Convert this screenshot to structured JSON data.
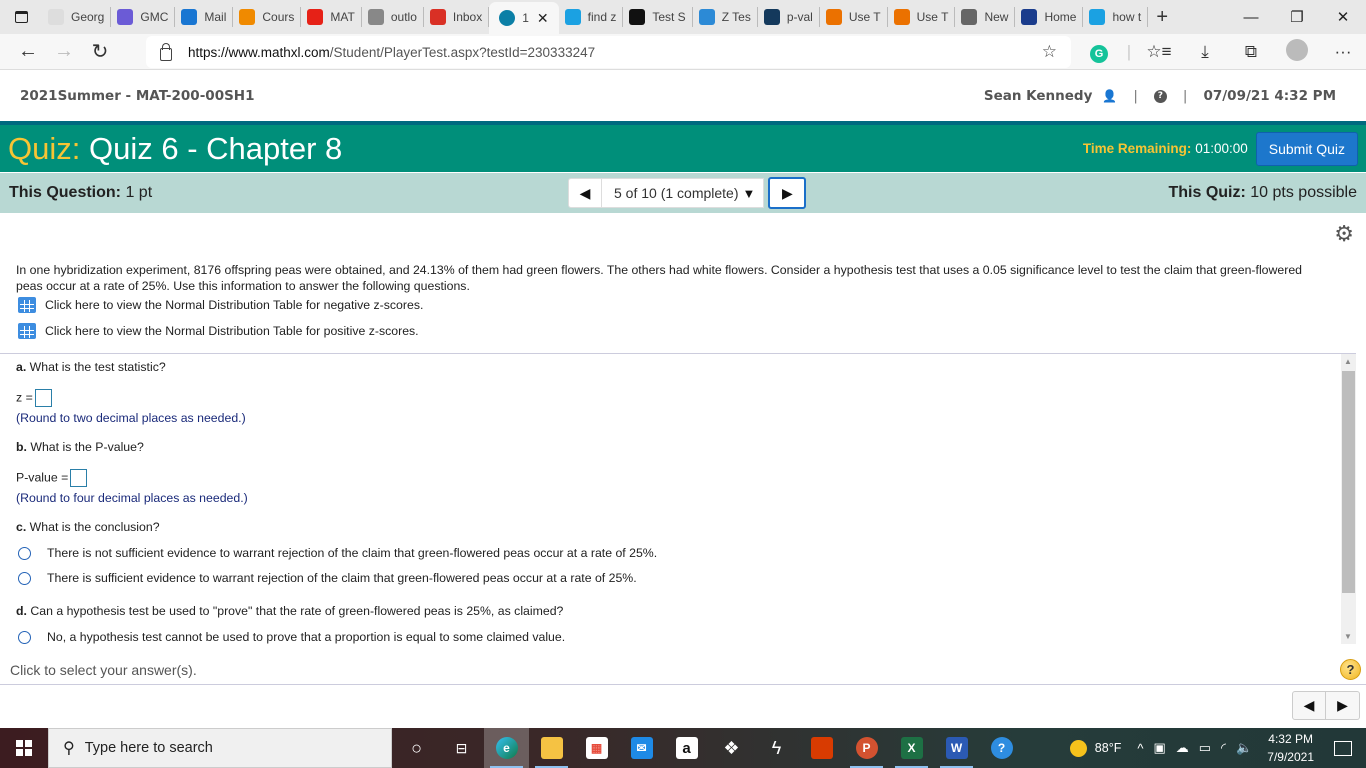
{
  "browser": {
    "tabs": [
      {
        "label": "Georg",
        "icon": "gmc-icon",
        "color": "#ddd"
      },
      {
        "label": "GMC",
        "icon": "gmc-circle-icon",
        "color": "#6b5bd6"
      },
      {
        "label": "Mail",
        "icon": "outlook-icon",
        "color": "#1976d2"
      },
      {
        "label": "Cours",
        "icon": "moodle-icon",
        "color": "#f08a00"
      },
      {
        "label": "MAT",
        "icon": "youtube-icon",
        "color": "#e62117"
      },
      {
        "label": "outlo",
        "icon": "file-icon",
        "color": "#888"
      },
      {
        "label": "Inbox",
        "icon": "gmail-icon",
        "color": "#d93025"
      },
      {
        "label": "1",
        "icon": "pearson-icon",
        "color": "#0b7fa6",
        "active": true
      },
      {
        "label": "find z",
        "icon": "bing-icon",
        "color": "#1ba1e2"
      },
      {
        "label": "Test S",
        "icon": "l-icon",
        "color": "#111"
      },
      {
        "label": "Z Tes",
        "icon": "ztest-icon",
        "color": "#2c8ad6"
      },
      {
        "label": "p-val",
        "icon": "pval-icon",
        "color": "#14395c"
      },
      {
        "label": "Use T",
        "icon": "chegg-icon",
        "color": "#eb7100"
      },
      {
        "label": "Use T",
        "icon": "chegg-icon",
        "color": "#eb7100"
      },
      {
        "label": "New",
        "icon": "newtab-icon",
        "color": "#666"
      },
      {
        "label": "Home",
        "icon": "shield-star-icon",
        "color": "#1a3c8c"
      },
      {
        "label": "how t",
        "icon": "bing-icon",
        "color": "#1ba1e2"
      }
    ],
    "url_host": "https://www.mathxl.com",
    "url_path": "/Student/PlayerTest.aspx?testId=230333247"
  },
  "header": {
    "course": "2021Summer - MAT-200-00SH1",
    "user": "Sean Kennedy",
    "datetime": "07/09/21 4:32 PM"
  },
  "quiz": {
    "label": "Quiz:",
    "title": "Quiz 6 - Chapter 8",
    "time_label": "Time Remaining:",
    "time_value": "01:00:00",
    "submit_label": "Submit Quiz"
  },
  "question_bar": {
    "this_question_label": "This Question:",
    "this_question_value": "1 pt",
    "nav_selector": "5 of 10 (1 complete)",
    "this_quiz_label": "This Quiz:",
    "this_quiz_value": "10 pts possible"
  },
  "question": {
    "stem": "In one hybridization experiment, 8176 offspring peas were obtained, and 24.13% of them had green flowers. The others had white flowers. Consider a hypothesis test that uses a 0.05 significance level to test the claim that green-flowered peas occur at a rate of 25%. Use this information to answer the following questions.",
    "table_links": [
      "Click here to view the Normal Distribution Table for negative z-scores.",
      "Click here to view the Normal Distribution Table for positive z-scores."
    ],
    "part_a": {
      "letter": "a.",
      "text": " What is the test statistic?",
      "field_label": "z =",
      "value": "",
      "hint": "(Round to two decimal places as needed.)"
    },
    "part_b": {
      "letter": "b.",
      "text": " What is the P-value?",
      "field_label": "P-value =",
      "value": "",
      "hint": "(Round to four decimal places as needed.)"
    },
    "part_c": {
      "letter": "c.",
      "text": " What is the conclusion?",
      "options": [
        "There is not sufficient evidence to warrant rejection of the claim that green-flowered peas occur at a rate of 25%.",
        "There is sufficient evidence to warrant rejection of the claim that green-flowered peas occur at a rate of 25%."
      ]
    },
    "part_d": {
      "letter": "d.",
      "text": " Can a hypothesis test be used to \"prove\" that the rate of green-flowered peas is 25%, as claimed?",
      "options": [
        "No, a hypothesis test cannot be used to prove that a proportion is equal to some claimed value."
      ]
    }
  },
  "footer": {
    "instruction": "Click to select your answer(s).",
    "help": "?"
  },
  "taskbar": {
    "search_placeholder": "Type here to search",
    "weather": "88°F",
    "time": "4:32 PM",
    "date": "7/9/2021"
  }
}
